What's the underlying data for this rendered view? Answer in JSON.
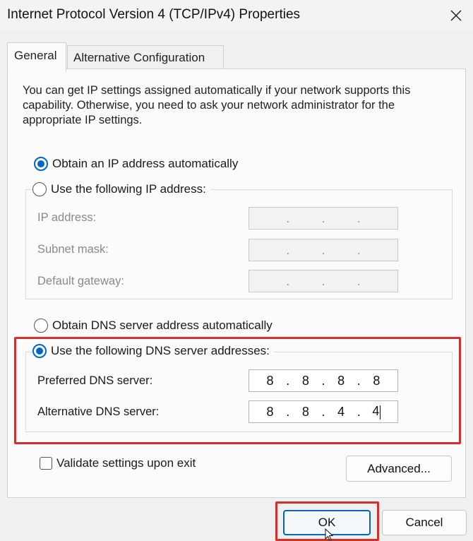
{
  "window": {
    "title": "Internet Protocol Version 4 (TCP/IPv4) Properties"
  },
  "tabs": [
    "General",
    "Alternative Configuration"
  ],
  "description": "You can get IP settings assigned automatically if your network supports this capability. Otherwise, you need to ask your network administrator for the appropriate IP settings.",
  "ip": {
    "auto_label": "Obtain an IP address automatically",
    "manual_label": "Use the following IP address:",
    "auto_selected": true,
    "fields": [
      {
        "label": "IP address:",
        "value": [
          "",
          "",
          "",
          ""
        ]
      },
      {
        "label": "Subnet mask:",
        "value": [
          "",
          "",
          "",
          ""
        ]
      },
      {
        "label": "Default gateway:",
        "value": [
          "",
          "",
          "",
          ""
        ]
      }
    ]
  },
  "dns": {
    "auto_label": "Obtain DNS server address automatically",
    "manual_label": "Use the following DNS server addresses:",
    "manual_selected": true,
    "preferred": {
      "label": "Preferred DNS server:",
      "octets": [
        "8",
        "8",
        "8",
        "8"
      ]
    },
    "alternative": {
      "label": "Alternative DNS server:",
      "octets": [
        "8",
        "8",
        "4",
        "4"
      ]
    }
  },
  "validate": {
    "label": "Validate settings upon exit",
    "checked": false
  },
  "buttons": {
    "advanced": "Advanced...",
    "ok": "OK",
    "cancel": "Cancel"
  },
  "colors": {
    "accent": "#0067c0",
    "highlight": "#d32f2f"
  },
  "icons": {
    "close": "close-icon",
    "cursor": "mouse-pointer-icon"
  }
}
